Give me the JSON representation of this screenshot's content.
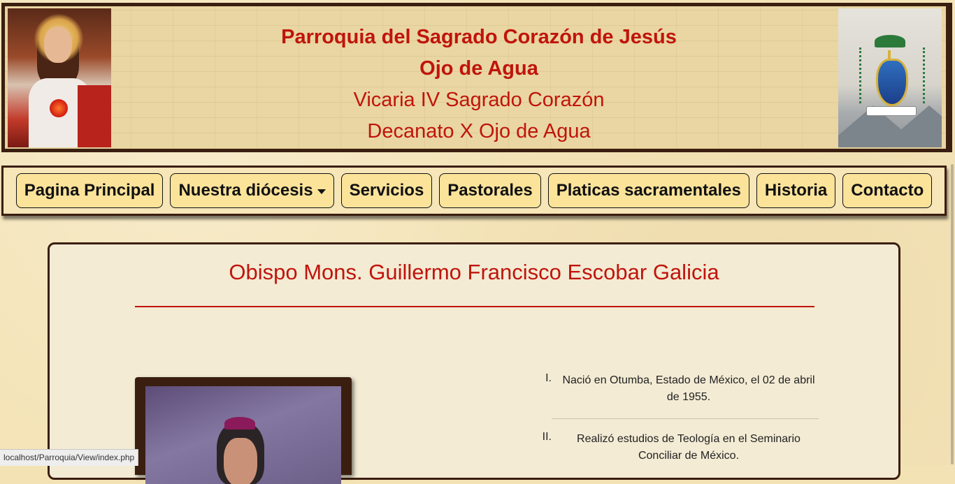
{
  "header": {
    "title_line1": "Parroquia del Sagrado Corazón de Jesús",
    "title_line2": "Ojo de Agua",
    "subtitle_line1": "Vicaria IV Sagrado Corazón",
    "subtitle_line2": "Decanato X Ojo de Agua",
    "left_image_icon": "sacred-heart-image",
    "right_image_icon": "diocese-coat-of-arms-image"
  },
  "nav": {
    "items": [
      {
        "label": "Pagina Principal"
      },
      {
        "label": "Nuestra diócesis",
        "dropdown": true
      },
      {
        "label": "Servicios"
      },
      {
        "label": "Pastorales"
      },
      {
        "label": "Platicas sacramentales"
      },
      {
        "label": "Historia"
      },
      {
        "label": "Contacto"
      }
    ]
  },
  "main": {
    "title": "Obispo Mons. Guillermo Francisco Escobar Galicia",
    "facts": [
      {
        "num": "I.",
        "text": "Nació en Otumba, Estado de México, el 02 de abril de 1955."
      },
      {
        "num": "II.",
        "text": "Realizó estudios de Teología en el Seminario Conciliar de México."
      }
    ]
  },
  "status_bar": {
    "url": "localhost/Parroquia/View/index.php"
  },
  "colors": {
    "accent_red": "#c0140c",
    "frame_brown": "#3a1e10",
    "nav_button_bg": "#fbe39a",
    "page_bg": "#f4e4b8"
  }
}
